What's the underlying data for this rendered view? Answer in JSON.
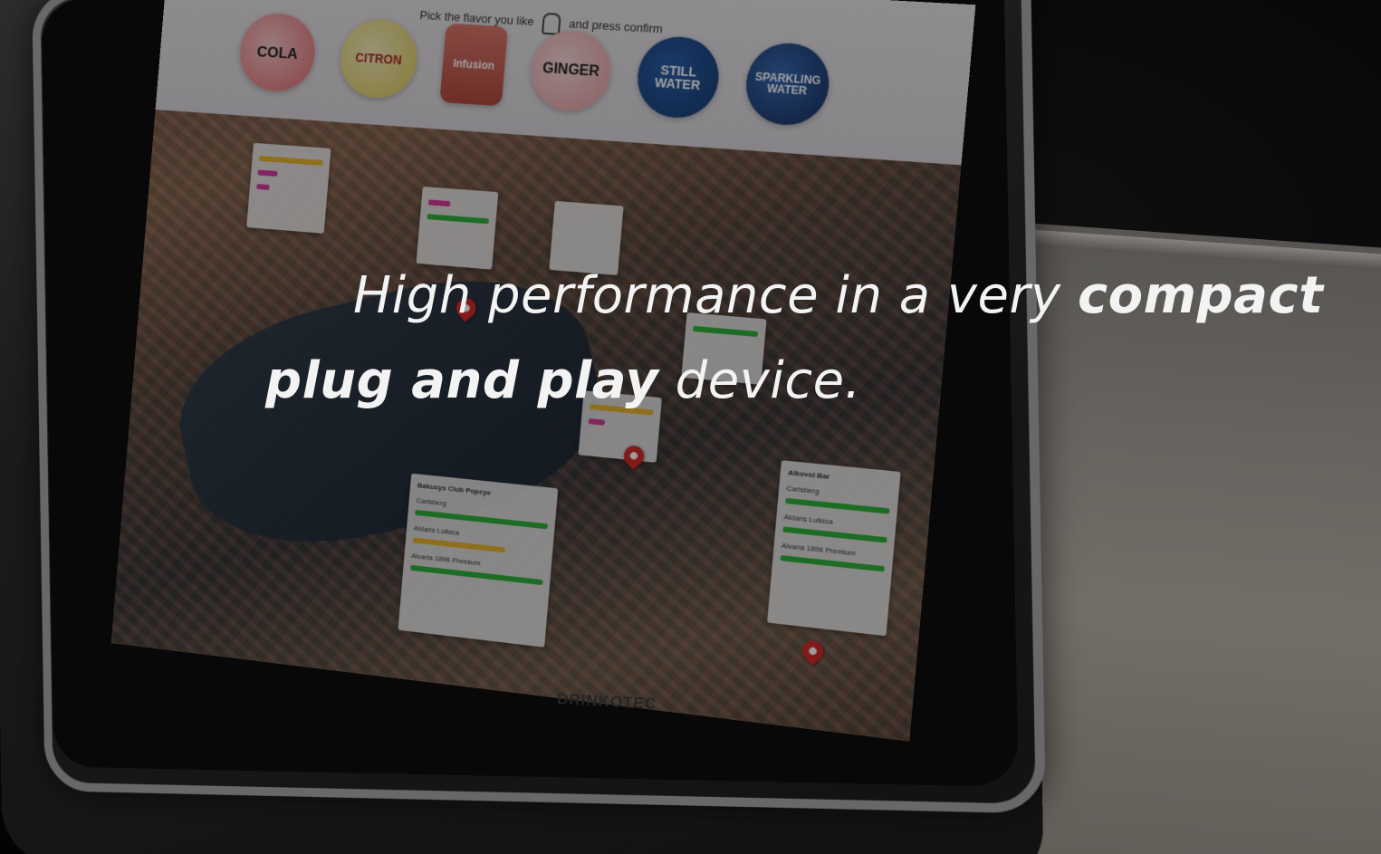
{
  "headline": {
    "line1_light": "High performance in a very",
    "line1_bold": "compact",
    "line2_bold": "plug and play",
    "line2_light": "device."
  },
  "device": {
    "brand": "DRINKOTEC",
    "prompt_left": "Pick the flavor you like",
    "prompt_right": "and press confirm",
    "flavors": [
      "COLA",
      "CITRON",
      "Infusion",
      "GINGER",
      "STILL WATER",
      "SPARKLING WATER"
    ],
    "panels": [
      {
        "title": "Bakusys Club Popeye",
        "rows": [
          "Carlsberg",
          "Aldaris Lutkica",
          "Alvaria 1896 Premium"
        ]
      },
      {
        "title": "Alkovol Bar",
        "rows": [
          "Carlsberg",
          "Aldaris Lutkica",
          "Alvaria 1896 Premium"
        ]
      }
    ]
  }
}
